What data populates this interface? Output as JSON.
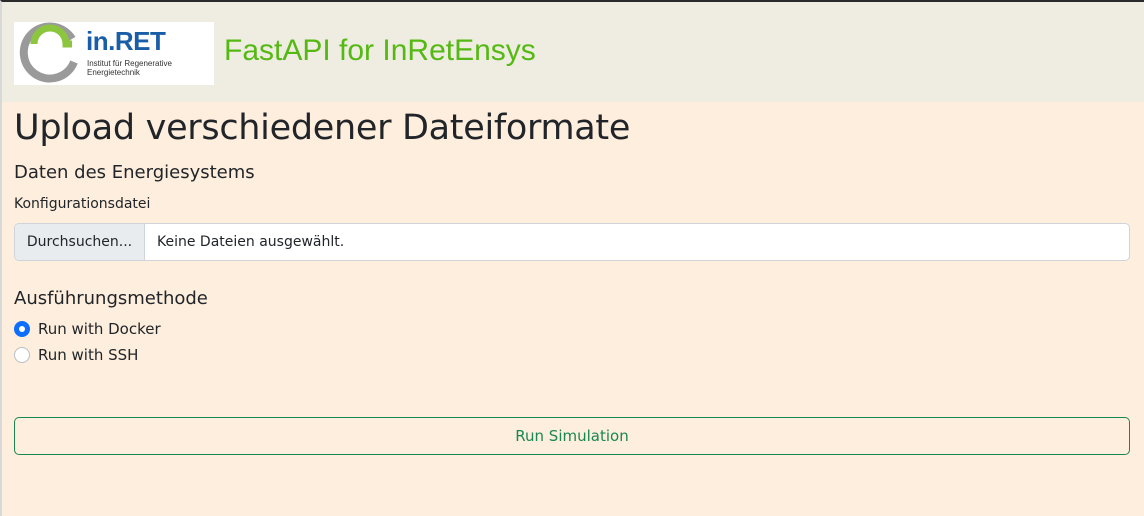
{
  "header": {
    "logo": {
      "name": "in.RET",
      "subtitle": "Institut für Regenerative Energietechnik",
      "colors": {
        "name": "#1b5ea8",
        "ring_outer": "#9a9a9a",
        "ring_inner": "#8cc63f"
      }
    },
    "app_title": "FastAPI for InRetEnsys"
  },
  "main": {
    "page_title": "Upload verschiedener Dateiformate",
    "system_section": {
      "title": "Daten des Energiesystems",
      "config_label": "Konfigurationsdatei",
      "file_input": {
        "button_label": "Durchsuchen...",
        "status": "Keine Dateien ausgewählt."
      }
    },
    "method_section": {
      "title": "Ausführungsmethode",
      "options": [
        {
          "label": "Run with Docker",
          "selected": true
        },
        {
          "label": "Run with SSH",
          "selected": false
        }
      ]
    },
    "run_button_label": "Run Simulation"
  },
  "colors": {
    "header_bg": "#efece1",
    "page_bg": "#fdeedd",
    "accent_green": "#55b913",
    "button_green": "#198754",
    "radio_blue": "#0d6efd"
  }
}
